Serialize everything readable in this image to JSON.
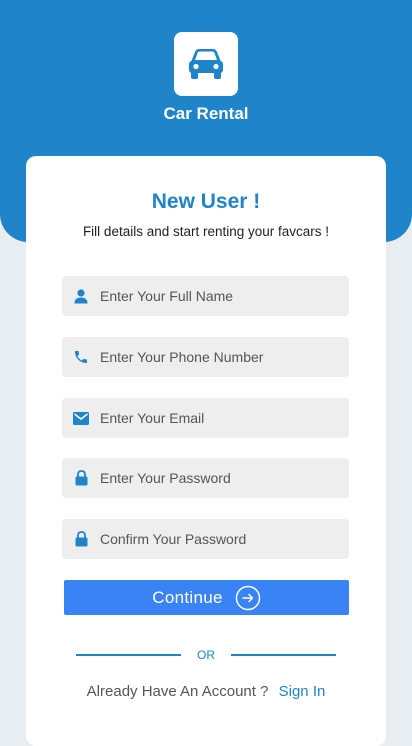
{
  "app": {
    "title": "Car Rental"
  },
  "colors": {
    "primary": "#1f84c9",
    "button": "#3a83f5",
    "field_bg": "#eeeeee",
    "page_bg": "#e8edf1"
  },
  "card": {
    "title": "New User !",
    "subtitle": "Fill details and start renting your favcars !"
  },
  "fields": {
    "full_name": {
      "placeholder": "Enter Your Full Name",
      "icon": "person-icon"
    },
    "phone": {
      "placeholder": "Enter Your Phone Number",
      "icon": "phone-icon"
    },
    "email": {
      "placeholder": "Enter Your Email",
      "icon": "mail-icon"
    },
    "password": {
      "placeholder": "Enter Your Password",
      "icon": "lock-icon"
    },
    "confirm_password": {
      "placeholder": "Confirm Your Password",
      "icon": "lock-icon"
    }
  },
  "continue_button": {
    "label": "Continue",
    "icon": "arrow-right-circle-icon"
  },
  "divider": {
    "label": "OR"
  },
  "signin": {
    "prompt": "Already Have An Account ?",
    "link": "Sign In"
  }
}
